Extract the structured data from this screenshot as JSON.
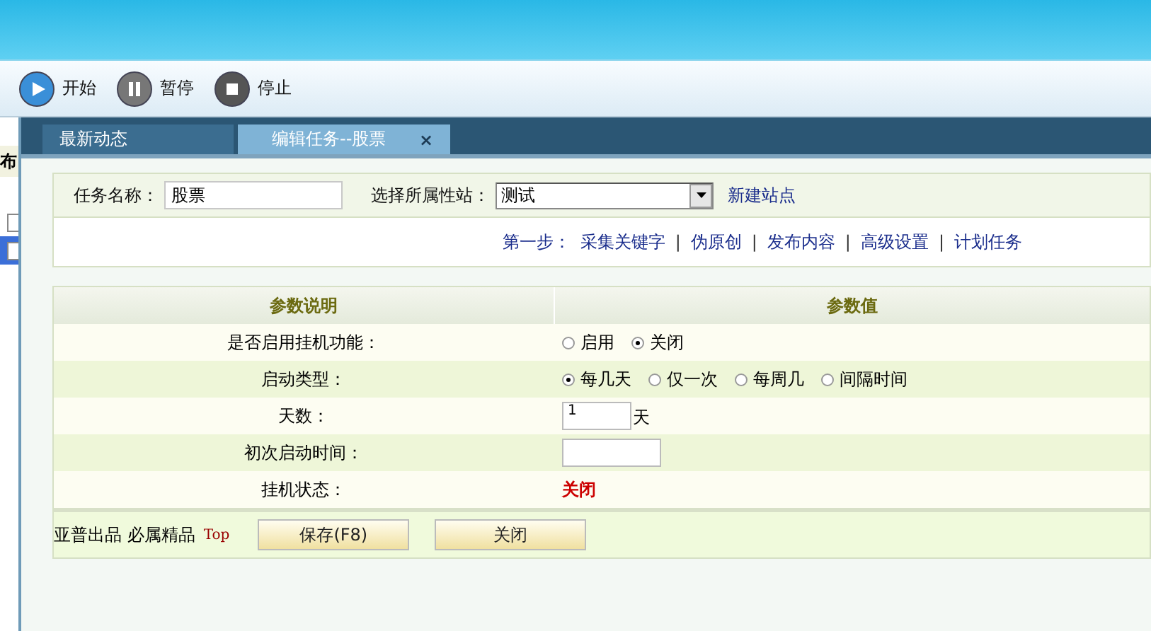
{
  "toolbar": [
    {
      "label": "开始",
      "kind": "play"
    },
    {
      "label": "暂停",
      "kind": "pause"
    },
    {
      "label": "停止",
      "kind": "stop"
    }
  ],
  "sidebar": {
    "header": "布",
    "items": [
      {
        "selected": false
      },
      {
        "selected": true
      }
    ]
  },
  "tabs": [
    {
      "label": "最新动态",
      "selected": false
    },
    {
      "label": "编辑任务--股票",
      "selected": true,
      "close": "×"
    }
  ],
  "task_form": {
    "name_label": "任务名称：",
    "name_value": "股票",
    "site_label": "选择所属性站：",
    "site_value": "测试",
    "new_site_link": "新建站点",
    "steps_label": "第一步：",
    "steps": [
      "采集关键字",
      "伪原创",
      "发布内容",
      "高级设置",
      "计划任务"
    ],
    "separators": [
      "|",
      "|",
      "|",
      "|"
    ]
  },
  "params": {
    "columns": [
      "参数说明",
      "参数值"
    ],
    "rows": [
      {
        "label": "是否启用挂机功能：",
        "kind": "radio",
        "options": [
          {
            "label": "启用",
            "selected": false
          },
          {
            "label": "关闭",
            "selected": true
          }
        ]
      },
      {
        "label": "启动类型：",
        "kind": "radio",
        "options": [
          {
            "label": "每几天",
            "selected": true
          },
          {
            "label": "仅一次",
            "selected": false
          },
          {
            "label": "每周几",
            "selected": false
          },
          {
            "label": "间隔时间",
            "selected": false
          }
        ]
      },
      {
        "label": "天数：",
        "kind": "input",
        "value": "1",
        "unit": "天"
      },
      {
        "label": "初次启动时间：",
        "kind": "input"
      },
      {
        "label": "挂机状态：",
        "kind": "status",
        "value": "关闭"
      }
    ]
  },
  "footer": {
    "credit": "亚普出品 必属精品",
    "top_link": "Top",
    "buttons": [
      "保存(F8)",
      "关闭"
    ]
  }
}
